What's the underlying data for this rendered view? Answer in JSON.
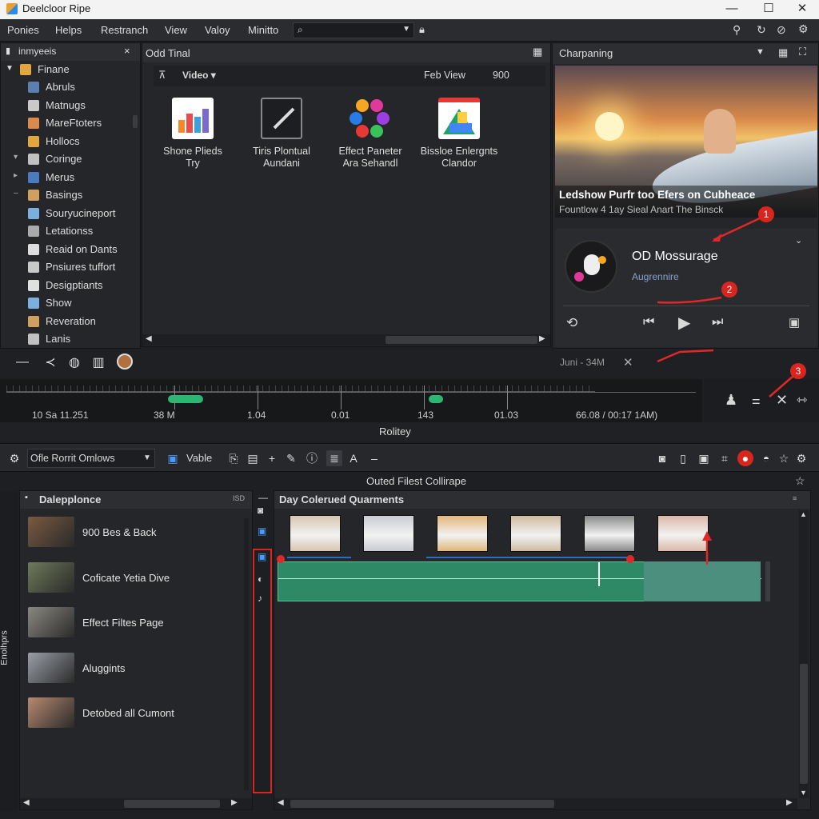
{
  "window": {
    "title": "Deelcloor Ripe",
    "min": "—",
    "max": "☐",
    "close": "✕"
  },
  "menu": [
    "Ponies",
    "Helps",
    "Restranch",
    "View",
    "Valoy",
    "Minitto"
  ],
  "left_panel": {
    "header": "inmyeeis",
    "root": "Finane",
    "items": [
      "Abruls",
      "Matnugs",
      "MareFtoters",
      "Hollocs",
      "Coringe",
      "Merus",
      "Basings",
      "Souryucineport",
      "Letationss",
      "Reaid on Dants",
      "Pnsiures tuffort",
      "Desigptiants",
      "Show",
      "Reveration",
      "Lanis"
    ],
    "item_colors": [
      "#5a7fb0",
      "#c9c9c9",
      "#d98c4a",
      "#e0a640",
      "#c0c0c0",
      "#4a7abf",
      "#d0a060",
      "#7ab0e0",
      "#aaaaaa",
      "#dddddd",
      "#c9c9c9",
      "#e0e0e0",
      "#7ab0e0",
      "#d0a060",
      "#c0c0c0"
    ]
  },
  "center_panel": {
    "header": "Odd Tinal",
    "filter_label": "Video",
    "view_label": "Feb View",
    "view_value": "900",
    "tiles": [
      {
        "line1": "Shone Plieds",
        "line2": "Try"
      },
      {
        "line1": "Tiris Plontual",
        "line2": "Aundani"
      },
      {
        "line1": "Effect Paneter",
        "line2": "Ara Sehandl"
      },
      {
        "line1": "Bissloe Enlergnts",
        "line2": "Clandor"
      }
    ]
  },
  "right_panel": {
    "header": "Charpaning",
    "preview_title": "Ledshow Purfr too Efers on Cubheace",
    "preview_sub": "Fountlow 4 1ay Sieal Anart The Binsck",
    "player_title": "OD Mossurage",
    "player_sub": "Augrennire"
  },
  "status": {
    "text": "Juni - 34M",
    "close": "✕"
  },
  "ruler": {
    "labels": [
      "10 Sa 11.251",
      "38 M",
      "1.04",
      "0.01",
      "143",
      "01.03",
      "66.08 / 00:17 1AM)"
    ]
  },
  "divider_label": "Rolitey",
  "toolbar": {
    "dropdown": "Ofle Rorrit Omlows",
    "vable": "Vable"
  },
  "timeline": {
    "caption": "Outed Filest Collirape",
    "track_header": "Day Colerued Quarments",
    "clip_colors": [
      "#d7c6b0",
      "#c8ccd2",
      "#e1b67a",
      "#cdbba0",
      "#8a8a8a",
      "#d9b8a8"
    ]
  },
  "media_panel": {
    "header": "Dalepplonce",
    "header_badge": "ISD",
    "side_label": "Enolhprs",
    "items": [
      {
        "label": "900 Bes & Back",
        "color": "#7a5a40"
      },
      {
        "label": "Coficate Yetia Dive",
        "color": "#6e7a5a"
      },
      {
        "label": "Effect Filtes Page",
        "color": "#8a8880"
      },
      {
        "label": "Aluggints",
        "color": "#9aa0a8"
      },
      {
        "label": "Detobed all Cumont",
        "color": "#b88a70"
      }
    ]
  },
  "annotations": {
    "badges": [
      "1",
      "2",
      "3"
    ]
  },
  "colors": {
    "accent_green": "#2bb673",
    "track_green": "#2e8a66",
    "red": "#e02828"
  }
}
